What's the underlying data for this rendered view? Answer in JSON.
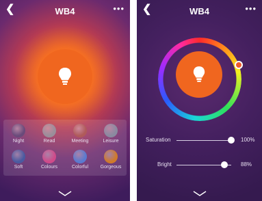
{
  "left_screen": {
    "header": {
      "back_icon": "chevron-left-icon",
      "title": "WB4",
      "more_icon": "more-dots-icon"
    },
    "bulb_icon": "lightbulb-icon",
    "scenes": [
      {
        "label": "Night",
        "color": "#6a4a7a"
      },
      {
        "label": "Read",
        "color": "#9a8e9a"
      },
      {
        "label": "Meeting",
        "color": "#b05a5a"
      },
      {
        "label": "Leisure",
        "color": "#8a8aa0"
      },
      {
        "label": "Soft",
        "color": "#4a5aa0"
      },
      {
        "label": "Colours",
        "color": "#d04a8a"
      },
      {
        "label": "Colorful",
        "color": "#5a7ad0"
      },
      {
        "label": "Gorgeous",
        "color": "#d07a2a"
      }
    ],
    "expand_icon": "chevron-down-icon"
  },
  "right_screen": {
    "header": {
      "back_icon": "chevron-left-icon",
      "title": "WB4",
      "more_icon": "more-dots-icon"
    },
    "bulb_icon": "lightbulb-icon",
    "saturation": {
      "label": "Saturation",
      "value_text": "100%",
      "value": 100
    },
    "bright": {
      "label": "Bright",
      "value_text": "88%",
      "value": 88
    },
    "expand_icon": "chevron-down-icon"
  },
  "colors": {
    "bulb": "#f0661f",
    "panel": "#3e1c5c",
    "accent": "#ef5a2a"
  }
}
